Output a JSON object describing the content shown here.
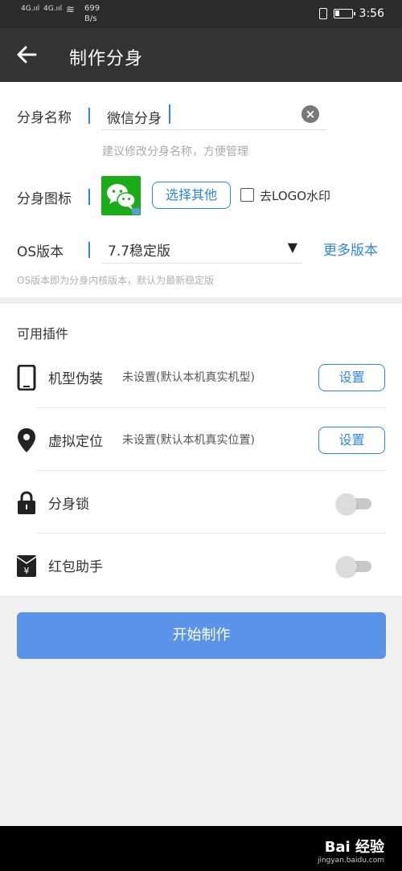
{
  "status_bar": {
    "signal1": "4G",
    "signal2": "4G",
    "speed_value": "699",
    "speed_unit": "B/s",
    "time": "3:56"
  },
  "header": {
    "title": "制作分身"
  },
  "form": {
    "name_label": "分身名称",
    "name_value": "微信分身",
    "name_hint": "建议修改分身名称，方便管理",
    "icon_label": "分身图标",
    "choose_other": "选择其他",
    "remove_logo_label": "去LOGO水印",
    "os_label": "OS版本",
    "os_value": "7.7稳定版",
    "more_versions": "更多版本",
    "os_hint": "OS版本即为分身内核版本，默认为最新稳定版"
  },
  "plugins": {
    "heading": "可用插件",
    "items": [
      {
        "name": "机型伪装",
        "desc": "未设置(默认本机真实机型)",
        "action": "设置",
        "icon": "phone-icon"
      },
      {
        "name": "虚拟定位",
        "desc": "未设置(默认本机真实位置)",
        "action": "设置",
        "icon": "location-pin-icon"
      },
      {
        "name": "分身锁",
        "toggle": false,
        "icon": "lock-icon"
      },
      {
        "name": "红包助手",
        "toggle": false,
        "icon": "red-envelope-icon"
      }
    ]
  },
  "start_button": "开始制作",
  "watermark": {
    "brand": "Bai 经验",
    "url": "jingyan.baidu.com"
  },
  "colors": {
    "accent": "#2e86de",
    "primary_button": "#5a93e8",
    "titlebar": "#333333",
    "wechat_green": "#1aad19"
  }
}
